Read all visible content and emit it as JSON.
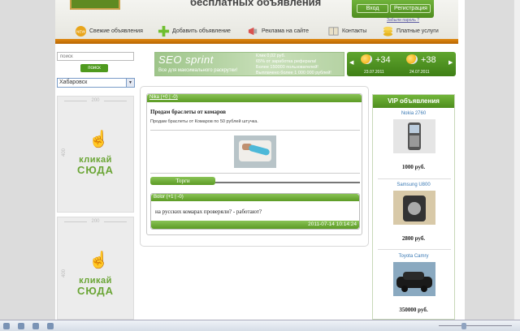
{
  "header": {
    "site_title": "бесплатных объявления",
    "login": "Вход",
    "register": "Регистрация",
    "forgot": "Забыли пароль ?"
  },
  "nav": [
    {
      "label": "Свежие объявления",
      "icon": "new-badge-icon"
    },
    {
      "label": "Добавить объявление",
      "icon": "plus-icon"
    },
    {
      "label": "Реклама на сайте",
      "icon": "megaphone-icon"
    },
    {
      "label": "Контакты",
      "icon": "book-icon"
    },
    {
      "label": "Платные услуги",
      "icon": "coins-icon"
    }
  ],
  "sidebar": {
    "search_placeholder": "поиск",
    "search_button": "поиск",
    "city": "Хабаровск",
    "banners": [
      {
        "width": "200",
        "height": "400",
        "line1": "кликай",
        "line2": "СЮДА"
      },
      {
        "width": "200",
        "height": "400",
        "line1": "кликай",
        "line2": "СЮДА"
      }
    ]
  },
  "seo": {
    "title": "SEO sprint",
    "subtitle": "Все для максимального раскрутки!",
    "lines": [
      "Клик 0,02 руб.",
      "65% от заработка реферала!",
      "Более 150000 пользователей!",
      "Выплачено более 1 000 000 рублей!"
    ]
  },
  "weather": {
    "days": [
      {
        "temp": "+34",
        "date": "23.07.2011"
      },
      {
        "temp": "+38",
        "date": "24.07.2011"
      }
    ]
  },
  "post": {
    "author": "Nika (+0 | -0)",
    "title": "Продам браслеты от комаров",
    "text": "Продам браслеты от Комаров по 50 рублей штучка.",
    "tab": "Торги",
    "comment": {
      "author": "Bolor (+1 | -0)",
      "text": "на русских комарах проверяли? - работают?",
      "timestamp": "2011-07-14 10:14:24"
    }
  },
  "vip": {
    "title": "VIP объявления",
    "items": [
      {
        "name": "Nokia 2760",
        "price": "1000 руб."
      },
      {
        "name": "Samsung U800",
        "price": "2800 руб."
      },
      {
        "name": "Toyota Camry",
        "price": "350000 руб."
      }
    ]
  }
}
